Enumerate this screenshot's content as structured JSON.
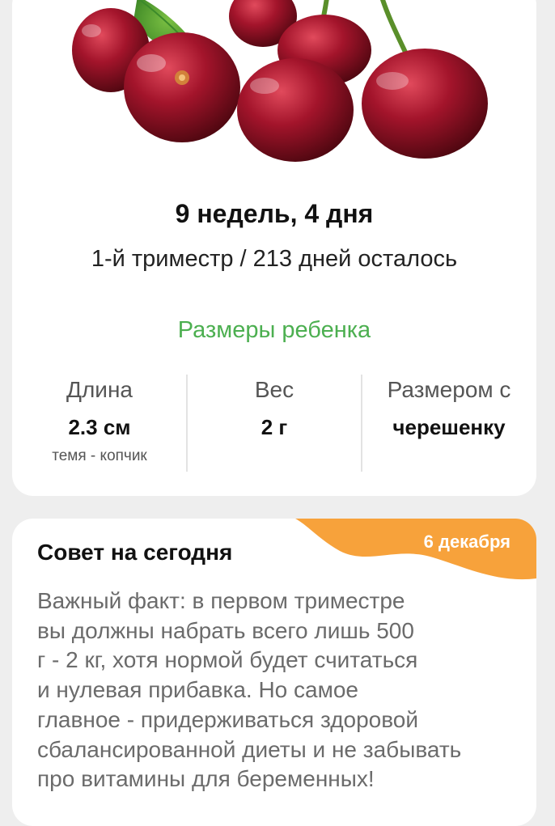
{
  "hero": {
    "image": "cherries-image"
  },
  "week": {
    "title": "9 недель, 4 дня",
    "subtitle": "1-й триместр / 213 дней осталось"
  },
  "baby_sizes": {
    "title": "Размеры ребенка",
    "length": {
      "label": "Длина",
      "value": "2.3 см",
      "note": "темя - копчик"
    },
    "weight": {
      "label": "Вес",
      "value": "2 г"
    },
    "comparison": {
      "label": "Размером с",
      "value": "черешенку"
    }
  },
  "tip": {
    "title": "Совет на сегодня",
    "date": "6 декабря",
    "text": "Важный факт: в первом триместре\nвы должны набрать всего лишь 500\nг - 2 кг, хотя нормой будет считаться\nи нулевая прибавка. Но самое\nглавное - придерживаться здоровой\nсбалансированной диеты и не забывать\nпро витамины для беременных!"
  },
  "colors": {
    "accent_green": "#4caf50",
    "accent_orange": "#f7a23b",
    "cherry_red": "#a3142b",
    "background": "#eeeeee",
    "card": "#ffffff"
  }
}
